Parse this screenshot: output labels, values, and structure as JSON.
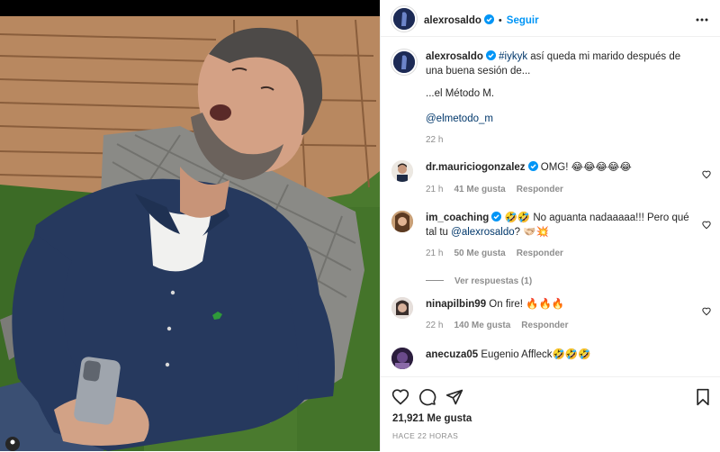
{
  "post": {
    "username": "alexrosaldo",
    "follow_label": "Seguir",
    "dot": "•",
    "caption": {
      "hashtag": "#iykyk",
      "text": " así queda mi marido después de una buena sesión de...",
      "line2": "...el Método M.",
      "mention": "@elmetodo_m",
      "time": "22 h"
    },
    "image": {
      "description_icon": "photo-of-man-sleeping-in-chair",
      "shirt_logo": "polo-logo"
    }
  },
  "comments": [
    {
      "username": "dr.mauriciogonzalez",
      "verified": true,
      "text": "OMG! 😂😂😂😂😂",
      "time": "21 h",
      "likes": "41 Me gusta",
      "reply": "Responder"
    },
    {
      "username": "im_coaching",
      "verified": true,
      "text_a": "🤣🤣 No aguanta nadaaaaa!!! Pero qué tal tu ",
      "mention": "@alexrosaldo",
      "text_b": "? 🫱🏻‍🫲🏼💥",
      "time": "21 h",
      "likes": "50 Me gusta",
      "reply": "Responder",
      "view_replies": "Ver respuestas (1)"
    },
    {
      "username": "ninapilbin99",
      "verified": false,
      "text": "On fire! 🔥🔥🔥",
      "time": "22 h",
      "likes": "140 Me gusta",
      "reply": "Responder"
    },
    {
      "username": "anecuza05",
      "verified": false,
      "text": "Eugenio Affleck🤣🤣🤣"
    }
  ],
  "footer": {
    "likes": "21,921 Me gusta",
    "ago": "HACE 22 HORAS"
  },
  "colors": {
    "accent": "#0095f6",
    "link": "#00376b",
    "muted": "#8e8e8e",
    "text": "#262626"
  },
  "icons": [
    "more-icon",
    "heart-icon",
    "comment-icon",
    "share-icon",
    "bookmark-icon",
    "verified-badge-icon"
  ]
}
